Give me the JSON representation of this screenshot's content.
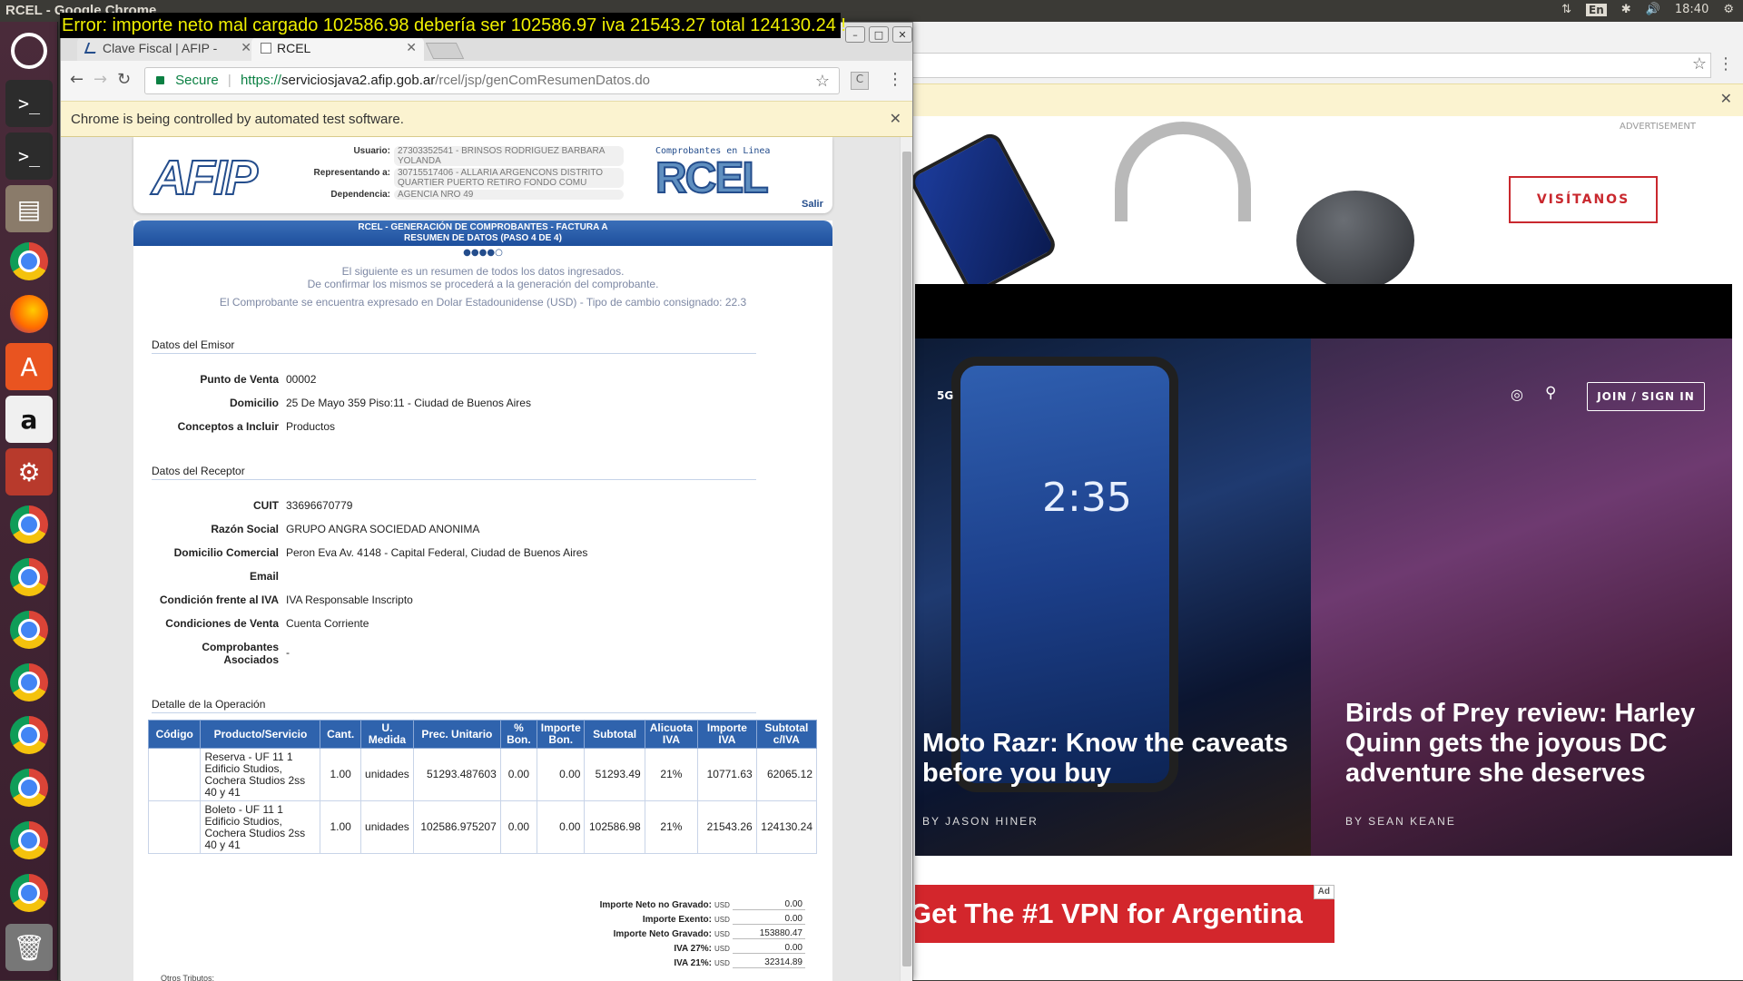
{
  "panel": {
    "title": "RCEL - Google Chrome",
    "time": "18:40",
    "keyboard": "En"
  },
  "error_message": "Error: importe neto mal cargado 102586.98 debería ser 102586.97 iva 21543.27 total 124130.24 !",
  "browser": {
    "tabs": [
      {
        "label": "Clave Fiscal | AFIP - "
      },
      {
        "label": "RCEL"
      }
    ],
    "url_secure_label": "Secure",
    "url_scheme": "https://",
    "url_host": "serviciosjava2.afip.gob.ar",
    "url_path": "/rcel/jsp/genComResumenDatos.do",
    "infobar": "Chrome is being controlled by automated test software."
  },
  "afip_header": {
    "logo": "AFIP",
    "usuario_label": "Usuario:",
    "usuario": "27303352541 - BRINSOS RODRIGUEZ BARBARA YOLANDA",
    "representando_label": "Representando a:",
    "representando": "30715517406 - ALLARIA ARGENCONS DISTRITO QUARTIER PUERTO RETIRO FONDO COMU",
    "dependencia_label": "Dependencia:",
    "dependencia": "AGENCIA NRO 49",
    "rcel_sub": "Comprobantes en Linea",
    "rcel_logo": "RCEL",
    "salir": "Salir"
  },
  "form": {
    "header_line1": "RCEL - GENERACIÓN DE COMPROBANTES - FACTURA A",
    "header_line2": "RESUMEN DE DATOS (PASO 4 DE 4)",
    "step_dots": "●●●●○",
    "intro1": "El siguiente es un resumen de todos los datos ingresados.",
    "intro2": "De confirmar los mismos se procederá a la generación del comprobante.",
    "currency_note": "El Comprobante se encuentra expresado en Dolar Estadounidense (USD) - Tipo de cambio consignado: 22.3",
    "emisor": {
      "title": "Datos del Emisor",
      "punto_venta_label": "Punto de Venta",
      "punto_venta": "00002",
      "domicilio_label": "Domicilio",
      "domicilio": "25 De Mayo 359 Piso:11 - Ciudad de Buenos Aires",
      "conceptos_label": "Conceptos a Incluir",
      "conceptos": "Productos"
    },
    "receptor": {
      "title": "Datos del Receptor",
      "cuit_label": "CUIT",
      "cuit": "33696670779",
      "razon_label": "Razón Social",
      "razon": "GRUPO ANGRA SOCIEDAD ANONIMA",
      "domcom_label": "Domicilio Comercial",
      "domcom": "Peron Eva Av. 4148 - Capital Federal, Ciudad de Buenos Aires",
      "email_label": "Email",
      "email": "",
      "iva_label": "Condición frente al IVA",
      "iva": "IVA Responsable Inscripto",
      "cond_label": "Condiciones de Venta",
      "cond": "Cuenta Corriente",
      "asoc_label1": "Comprobantes",
      "asoc_label2": "Asociados",
      "asoc": "-"
    },
    "detalle_title": "Detalle de la Operación",
    "table_headers": [
      "Código",
      "Producto/Servicio",
      "Cant.",
      "U. Medida",
      "Prec. Unitario",
      "% Bon.",
      "Importe Bon.",
      "Subtotal",
      "Alicuota IVA",
      "Importe IVA",
      "Subtotal c/IVA"
    ],
    "rows": [
      [
        "",
        "Reserva - UF 11 1 Edificio Studios, Cochera Studios 2ss 40 y 41",
        "1.00",
        "unidades",
        "51293.487603",
        "0.00",
        "0.00",
        "51293.49",
        "21%",
        "10771.63",
        "62065.12"
      ],
      [
        "",
        "Boleto - UF 11 1 Edificio Studios, Cochera Studios 2ss 40 y 41",
        "1.00",
        "unidades",
        "102586.975207",
        "0.00",
        "0.00",
        "102586.98",
        "21%",
        "21543.26",
        "124130.24"
      ]
    ],
    "totals": [
      {
        "label": "Importe Neto no Gravado:",
        "cur": "USD",
        "value": "0.00"
      },
      {
        "label": "Importe Exento:",
        "cur": "USD",
        "value": "0.00"
      },
      {
        "label": "Importe Neto Gravado:",
        "cur": "USD",
        "value": "153880.47"
      },
      {
        "label": "IVA 27%:",
        "cur": "USD",
        "value": "0.00"
      },
      {
        "label": "IVA 21%:",
        "cur": "USD",
        "value": "32314.89"
      }
    ],
    "otros_tributos": "Otros Tributos:"
  },
  "background_page": {
    "advertisement_label": "ADVERTISEMENT",
    "visit_button": "VISÍTANOS",
    "section_5g": "5G",
    "join_button": "JOIN / SIGN IN",
    "article1_title": "Moto Razr: Know the caveats before you buy",
    "article1_by": "BY JASON HINER",
    "article2_title": "Birds of Prey review: Harley Quinn gets the joyous DC adventure she deserves",
    "article2_by": "BY SEAN KEANE",
    "vpn_ad": "Get The #1 VPN for Argentina",
    "ad_tag": "Ad",
    "phone_clock": "2:35"
  },
  "colors": {
    "afip_blue": "#244d8c",
    "header_blue": "#2f63ad",
    "error_yellow": "#f0f000",
    "vpn_red": "#d3262c"
  }
}
